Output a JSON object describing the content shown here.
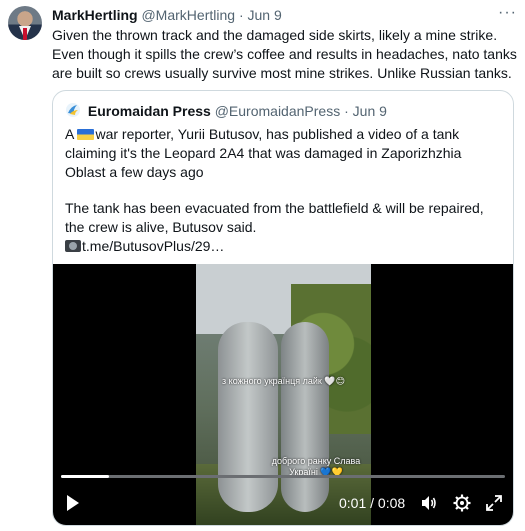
{
  "tweet": {
    "author_name": "MarkHertling",
    "author_handle": "@MarkHertling",
    "separator": "·",
    "date": "Jun 9",
    "more_icon": "more-icon",
    "text": "Given the thrown track and the damaged side skirts, likely a mine strike. Even though it spills the crew’s coffee and results in headaches, nato tanks are built so crews usually survive most mine strikes. Unlike Russian tanks."
  },
  "quote": {
    "author_name": "Euromaidan Press",
    "author_handle": "@EuromaidanPress",
    "separator": "·",
    "date": "Jun 9",
    "text_prefix": "A ",
    "text_para1": "war reporter, Yurii Butusov, has published a video of a tank claiming it's the Leopard 2A4 that was damaged in Zaporizhzhia Oblast a few days ago",
    "text_para2": "The tank has been evacuated from the battlefield & will be repaired, the crew is alive, Butusov said.",
    "link": "t.me/ButusovPlus/29…",
    "flag_icon": "ukraine-flag-icon",
    "camera_icon": "camera-icon"
  },
  "video": {
    "caption_top": "з кожного українця лайк 🤍😊",
    "caption_bottom": "доброго ранку Слава Україні 💙💛",
    "current_time": "0:01",
    "time_separator": " / ",
    "duration": "0:08",
    "progress": 0.108,
    "controls": [
      "play-icon",
      "volume-icon",
      "settings-icon",
      "fullscreen-icon"
    ]
  }
}
